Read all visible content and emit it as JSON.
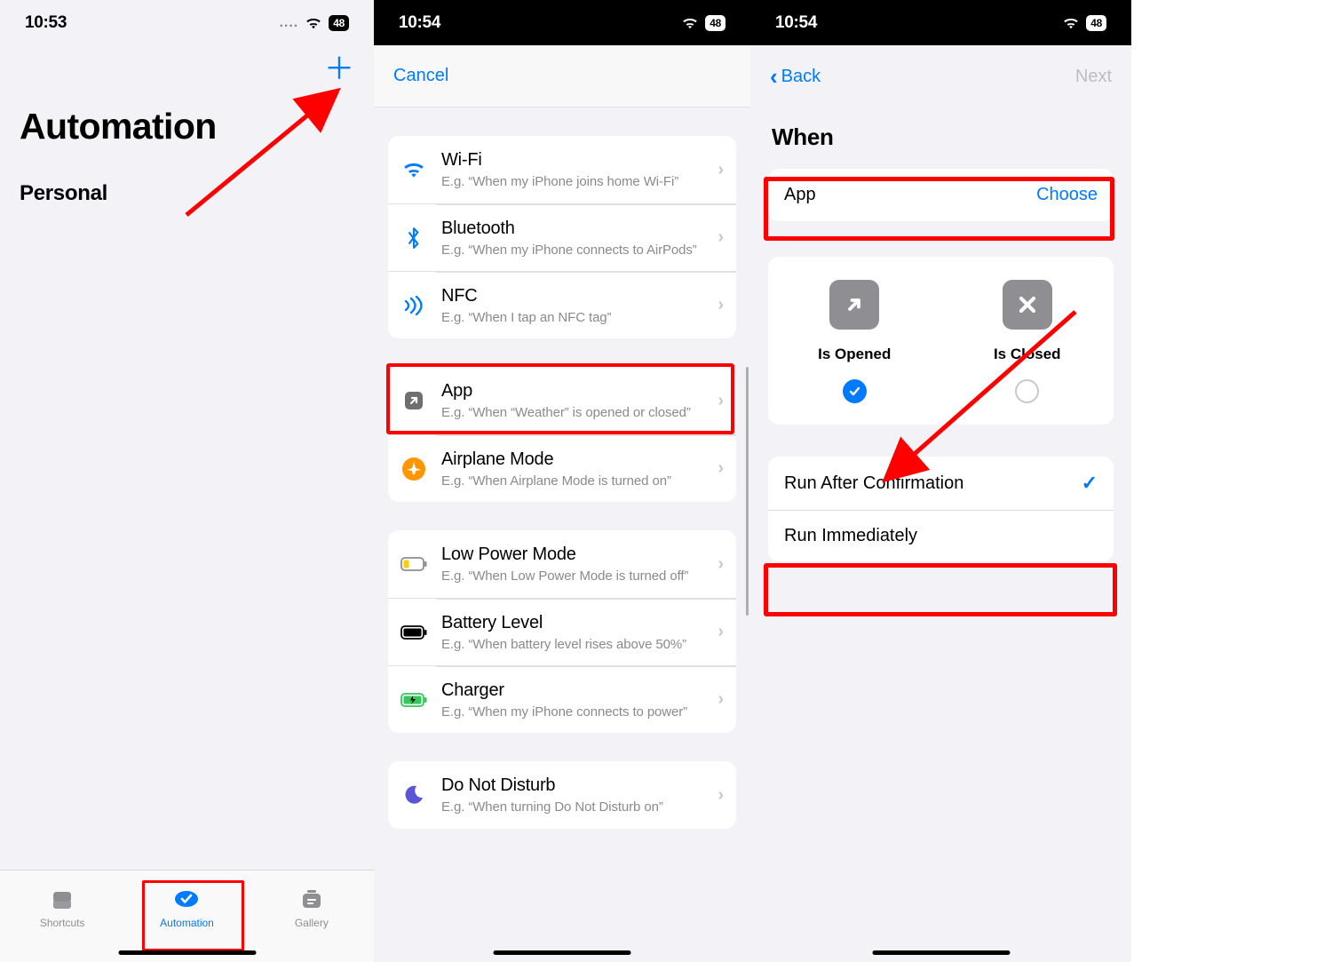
{
  "screen1": {
    "status_time": "10:53",
    "battery": "48",
    "plus_glyph": "＋",
    "title": "Automation",
    "subtitle": "Personal",
    "tabs": {
      "shortcuts": "Shortcuts",
      "automation": "Automation",
      "gallery": "Gallery"
    }
  },
  "screen2": {
    "status_time": "10:54",
    "battery": "48",
    "cancel": "Cancel",
    "groups": [
      {
        "items": [
          {
            "title": "Wi-Fi",
            "sub": "E.g. “When my iPhone joins home Wi-Fi”"
          },
          {
            "title": "Bluetooth",
            "sub": "E.g. “When my iPhone connects to AirPods”"
          },
          {
            "title": "NFC",
            "sub": "E.g. “When I tap an NFC tag”"
          }
        ]
      },
      {
        "items": [
          {
            "title": "App",
            "sub": "E.g. “When “Weather” is opened or closed”"
          },
          {
            "title": "Airplane Mode",
            "sub": "E.g. “When Airplane Mode is turned on”"
          }
        ]
      },
      {
        "items": [
          {
            "title": "Low Power Mode",
            "sub": "E.g. “When Low Power Mode is turned off”"
          },
          {
            "title": "Battery Level",
            "sub": "E.g. “When battery level rises above 50%”"
          },
          {
            "title": "Charger",
            "sub": "E.g. “When my iPhone connects to power”"
          }
        ]
      },
      {
        "items": [
          {
            "title": "Do Not Disturb",
            "sub": "E.g. “When turning Do Not Disturb on”"
          }
        ]
      }
    ]
  },
  "screen3": {
    "status_time": "10:54",
    "battery": "48",
    "back": "Back",
    "next": "Next",
    "when": "When",
    "app_label": "App",
    "choose": "Choose",
    "opened": "Is Opened",
    "closed": "Is Closed",
    "run_confirm": "Run After Confirmation",
    "run_immediate": "Run Immediately"
  }
}
